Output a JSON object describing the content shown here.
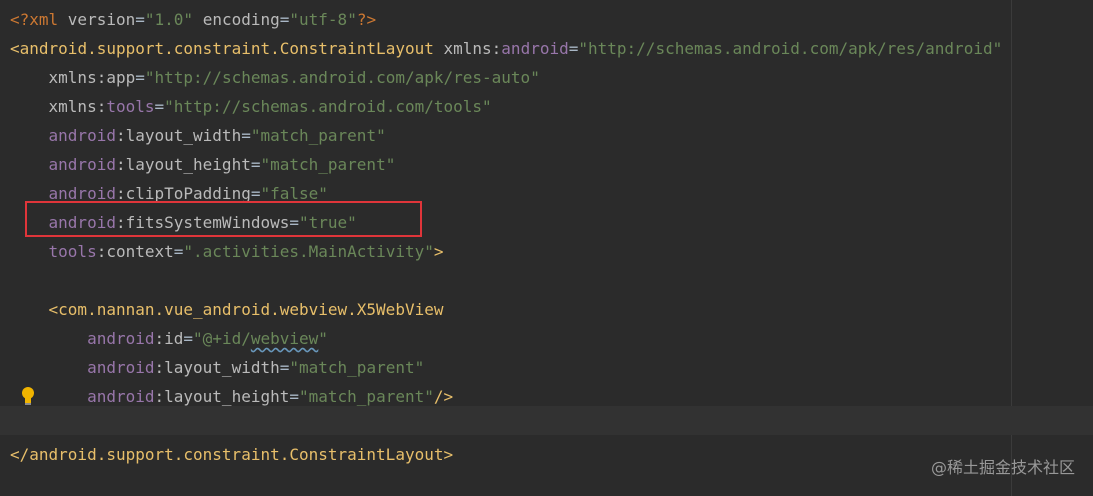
{
  "code_lines": [
    {
      "parts": [
        {
          "t": "<?xml ",
          "c": "punct"
        },
        {
          "t": "version",
          "c": "attr"
        },
        {
          "t": "=",
          "c": "plain"
        },
        {
          "t": "\"1.0\"",
          "c": "str"
        },
        {
          "t": " ",
          "c": "plain"
        },
        {
          "t": "encoding",
          "c": "attr"
        },
        {
          "t": "=",
          "c": "plain"
        },
        {
          "t": "\"utf-8\"",
          "c": "str"
        },
        {
          "t": "?>",
          "c": "punct"
        }
      ]
    },
    {
      "parts": [
        {
          "t": "<",
          "c": "tag"
        },
        {
          "t": "android.support.constraint.ConstraintLayout",
          "c": "tag"
        },
        {
          "t": " xmlns:",
          "c": "attr"
        },
        {
          "t": "android",
          "c": "ns"
        },
        {
          "t": "=",
          "c": "plain"
        },
        {
          "t": "\"http://schemas.android.com/apk/res/android\"",
          "c": "str"
        }
      ]
    },
    {
      "parts": [
        {
          "t": "    ",
          "c": "plain"
        },
        {
          "t": "xmlns:app",
          "c": "attr"
        },
        {
          "t": "=",
          "c": "plain"
        },
        {
          "t": "\"http://schemas.android.com/apk/res-auto\"",
          "c": "str"
        }
      ]
    },
    {
      "parts": [
        {
          "t": "    ",
          "c": "plain"
        },
        {
          "t": "xmlns:",
          "c": "attr"
        },
        {
          "t": "tools",
          "c": "ns"
        },
        {
          "t": "=",
          "c": "plain"
        },
        {
          "t": "\"http://schemas.android.com/tools\"",
          "c": "str"
        }
      ]
    },
    {
      "parts": [
        {
          "t": "    ",
          "c": "plain"
        },
        {
          "t": "android",
          "c": "ns"
        },
        {
          "t": ":layout_width",
          "c": "attr"
        },
        {
          "t": "=",
          "c": "plain"
        },
        {
          "t": "\"match_parent\"",
          "c": "str"
        }
      ]
    },
    {
      "parts": [
        {
          "t": "    ",
          "c": "plain"
        },
        {
          "t": "android",
          "c": "ns"
        },
        {
          "t": ":layout_height",
          "c": "attr"
        },
        {
          "t": "=",
          "c": "plain"
        },
        {
          "t": "\"match_parent\"",
          "c": "str"
        }
      ]
    },
    {
      "parts": [
        {
          "t": "    ",
          "c": "plain"
        },
        {
          "t": "android",
          "c": "ns"
        },
        {
          "t": ":clipToPadding",
          "c": "attr"
        },
        {
          "t": "=",
          "c": "plain"
        },
        {
          "t": "\"false\"",
          "c": "str"
        }
      ]
    },
    {
      "parts": [
        {
          "t": "    ",
          "c": "plain"
        },
        {
          "t": "android",
          "c": "ns"
        },
        {
          "t": ":fitsSystemWindows",
          "c": "attr"
        },
        {
          "t": "=",
          "c": "plain"
        },
        {
          "t": "\"true\"",
          "c": "str"
        }
      ]
    },
    {
      "parts": [
        {
          "t": "    ",
          "c": "plain"
        },
        {
          "t": "tools",
          "c": "ns"
        },
        {
          "t": ":context",
          "c": "attr"
        },
        {
          "t": "=",
          "c": "plain"
        },
        {
          "t": "\".activities.MainActivity\"",
          "c": "str"
        },
        {
          "t": ">",
          "c": "tag"
        }
      ]
    },
    {
      "parts": [
        {
          "t": "",
          "c": "plain"
        }
      ]
    },
    {
      "parts": [
        {
          "t": "    ",
          "c": "plain"
        },
        {
          "t": "<com.nannan.vue_android.webview.X5WebView",
          "c": "tag"
        }
      ]
    },
    {
      "parts": [
        {
          "t": "        ",
          "c": "plain"
        },
        {
          "t": "android",
          "c": "ns"
        },
        {
          "t": ":id",
          "c": "attr"
        },
        {
          "t": "=",
          "c": "plain"
        },
        {
          "t": "\"@+id/",
          "c": "str"
        },
        {
          "t": "webview",
          "c": "str",
          "sq": true
        },
        {
          "t": "\"",
          "c": "str"
        }
      ]
    },
    {
      "parts": [
        {
          "t": "        ",
          "c": "plain"
        },
        {
          "t": "android",
          "c": "ns"
        },
        {
          "t": ":layout_width",
          "c": "attr"
        },
        {
          "t": "=",
          "c": "plain"
        },
        {
          "t": "\"match_parent\"",
          "c": "str"
        }
      ]
    },
    {
      "parts": [
        {
          "t": "        ",
          "c": "plain"
        },
        {
          "t": "android",
          "c": "ns"
        },
        {
          "t": ":layout_height",
          "c": "attr"
        },
        {
          "t": "=",
          "c": "plain"
        },
        {
          "t": "\"match_parent\"",
          "c": "str"
        },
        {
          "t": "/>",
          "c": "tag"
        }
      ]
    },
    {
      "parts": [
        {
          "t": "",
          "c": "plain"
        }
      ]
    },
    {
      "parts": [
        {
          "t": "</android.support.constraint.ConstraintLayout>",
          "c": "tag"
        }
      ]
    }
  ],
  "highlighted_line_index": 7,
  "intention_icon": "lightbulb-icon",
  "watermark_text": "@稀土掘金技术社区",
  "colors": {
    "background": "#2b2b2b",
    "highlight_border": "#e0353a",
    "bulb": "#f0b400"
  }
}
